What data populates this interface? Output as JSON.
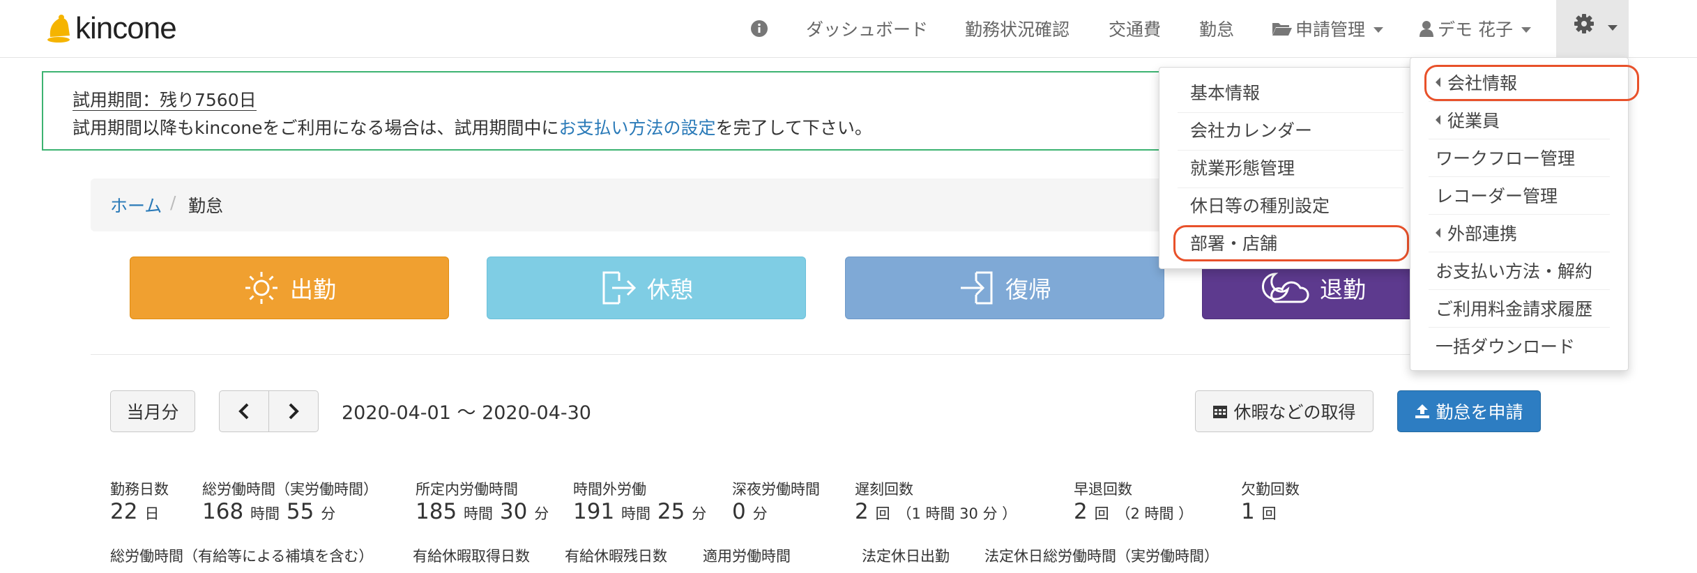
{
  "brand": {
    "name": "kincone"
  },
  "nav": {
    "dashboard": "ダッシュボード",
    "work_status": "勤務状況確認",
    "transport": "交通費",
    "attendance": "勤怠",
    "requests": "申請管理",
    "user": "デモ 花子"
  },
  "alert": {
    "title": "試用期間：残り7560日",
    "body_prefix": "試用期間以降もkinconeをご利用になる場合は、試用期間中に",
    "link": "お支払い方法の設定",
    "body_suffix": "を完了して下さい。"
  },
  "breadcrumb": {
    "home": "ホーム",
    "sep": "/",
    "current": "勤怠"
  },
  "actions": {
    "clock_in": "出勤",
    "break": "休憩",
    "return": "復帰",
    "clock_out": "退勤"
  },
  "toolbar": {
    "this_month": "当月分",
    "date_range": "2020-04-01 〜 2020-04-30",
    "leave": "休暇などの取得",
    "apply": "勤怠を申請"
  },
  "stats_row1": [
    {
      "label": "勤務日数",
      "v1": "22",
      "u1": "日"
    },
    {
      "label": "総労働時間（実労働時間）",
      "v1": "168",
      "u1": "時間",
      "v2": "55",
      "u2": "分"
    },
    {
      "label": "所定内労働時間",
      "v1": "185",
      "u1": "時間",
      "v2": "30",
      "u2": "分"
    },
    {
      "label": "時間外労働",
      "v1": "191",
      "u1": "時間",
      "v2": "25",
      "u2": "分"
    },
    {
      "label": "深夜労働時間",
      "v1": "0",
      "u1": "分"
    },
    {
      "label": "遅刻回数",
      "v1": "2",
      "u1": "回",
      "extra": "（1 時間 30 分 ）"
    },
    {
      "label": "早退回数",
      "v1": "2",
      "u1": "回",
      "extra": "（2 時間 ）"
    },
    {
      "label": "欠勤回数",
      "v1": "1",
      "u1": "回"
    }
  ],
  "stats_row2": [
    {
      "label": "総労働時間（有給等による補填を含む）"
    },
    {
      "label": "有給休暇取得日数"
    },
    {
      "label": "有給休暇残日数"
    },
    {
      "label": "適用労働時間"
    },
    {
      "label": "法定休日出勤"
    },
    {
      "label": "法定休日総労働時間（実労働時間）"
    }
  ],
  "settings_menu": [
    {
      "label": "会社情報",
      "submenu": true
    },
    {
      "label": "従業員",
      "submenu": true
    },
    {
      "label": "ワークフロー管理"
    },
    {
      "label": "レコーダー管理"
    },
    {
      "label": "外部連携",
      "submenu": true
    },
    {
      "label": "お支払い方法・解約"
    },
    {
      "label": "ご利用料金請求履歴"
    },
    {
      "label": "一括ダウンロード"
    }
  ],
  "company_submenu": [
    {
      "label": "基本情報"
    },
    {
      "label": "会社カレンダー"
    },
    {
      "label": "就業形態管理"
    },
    {
      "label": "休日等の種別設定"
    },
    {
      "label": "部署・店舗"
    }
  ],
  "colors": {
    "clock_in": "#f0a030",
    "break": "#7fcde4",
    "return": "#7fa9d6",
    "clock_out": "#5d3a8e",
    "primary": "#2d7dc2",
    "highlight": "#e8512a"
  }
}
